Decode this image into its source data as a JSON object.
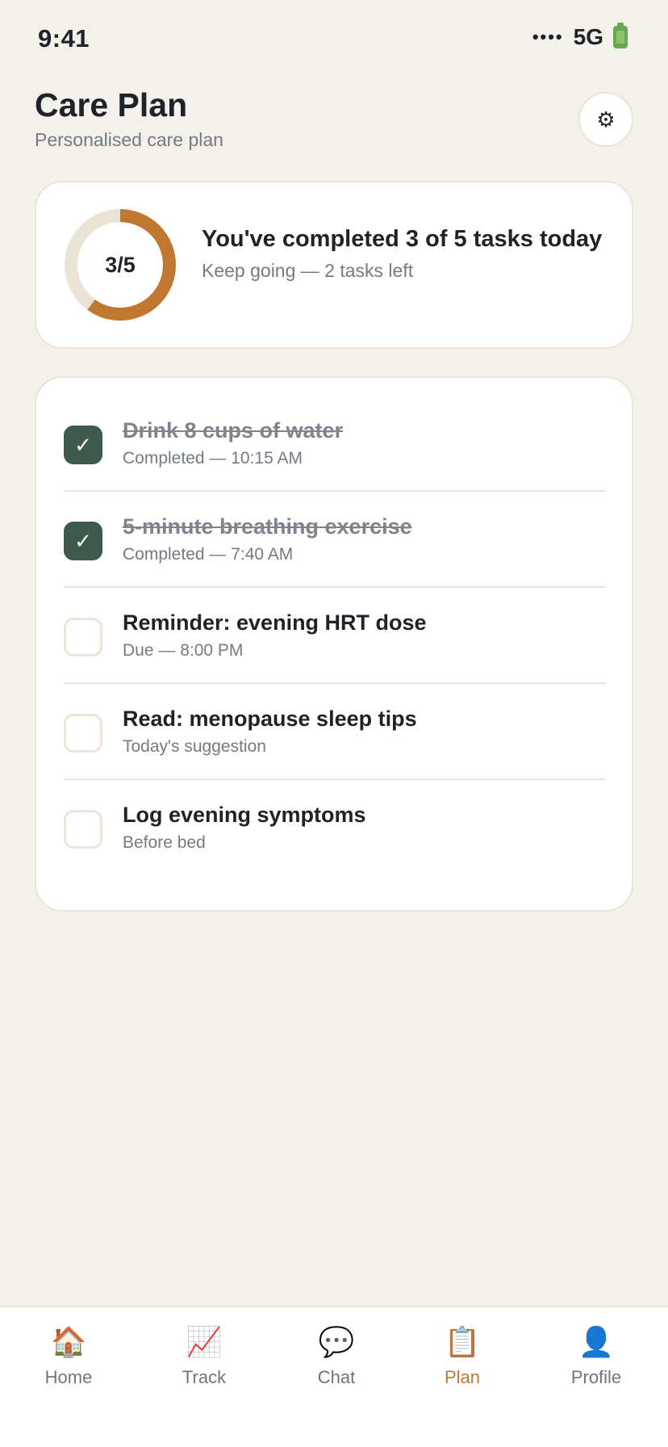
{
  "status_bar": {
    "time": "9:41",
    "signal": "••••",
    "network": "5G"
  },
  "header": {
    "title": "Care Plan",
    "subtitle": "Personalised care plan",
    "settings_icon": "⚙"
  },
  "summary": {
    "ring_label": "3/5",
    "completed": 3,
    "total": 5,
    "title": "You've completed 3 of 5 tasks today",
    "subtitle": "Keep going — 2 tasks left",
    "colors": {
      "progress": "#c07830",
      "track": "#ebe3d6"
    }
  },
  "tasks": [
    {
      "title": "Drink 8 cups of water",
      "meta": "Completed — 10:15 AM",
      "done": true
    },
    {
      "title": "5-minute breathing exercise",
      "meta": "Completed — 7:40 AM",
      "done": true
    },
    {
      "title": "Reminder: evening HRT dose",
      "meta": "Due — 8:00 PM",
      "done": false
    },
    {
      "title": "Read: menopause sleep tips",
      "meta": "Today's suggestion",
      "done": false
    },
    {
      "title": "Log evening symptoms",
      "meta": "Before bed",
      "done": false
    }
  ],
  "checkmark": "✓",
  "tab_bar": {
    "tabs": [
      {
        "label": "Home",
        "icon": "🏠",
        "icon_name": "home-icon"
      },
      {
        "label": "Track",
        "icon": "📈",
        "icon_name": "chart-icon"
      },
      {
        "label": "Chat",
        "icon": "💬",
        "icon_name": "chat-icon"
      },
      {
        "label": "Plan",
        "icon": "📋",
        "icon_name": "clipboard-icon",
        "active": true
      },
      {
        "label": "Profile",
        "icon": "👤",
        "icon_name": "profile-icon"
      }
    ]
  },
  "colors": {
    "background": "#f4f0ea",
    "accent": "#c07830",
    "check": "#3d5a4a"
  }
}
